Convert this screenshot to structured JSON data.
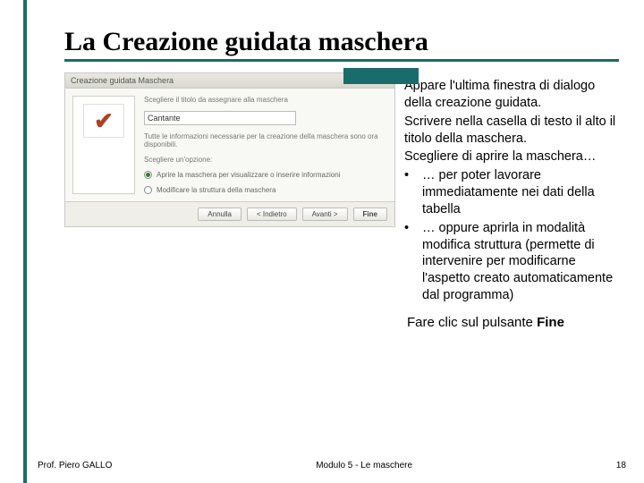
{
  "title": "La Creazione guidata maschera",
  "dialog": {
    "titlebar": "Creazione guidata Maschera",
    "prompt": "Scegliere il titolo da assegnare alla maschera",
    "input_value": "Cantante",
    "desc_line1": "Tutte le informazioni necessarie per la creazione della maschera sono ora disponibili.",
    "desc_line2": "Scegliere un'opzione:",
    "radio1": "Aprire la maschera per visualizzare o inserire informazioni",
    "radio2": "Modificare la struttura della maschera",
    "btn_cancel": "Annulla",
    "btn_back": "< Indietro",
    "btn_next": "Avanti >",
    "btn_finish": "Fine"
  },
  "body": {
    "p1": "Appare l'ultima finestra di dialogo della creazione guidata.",
    "p2": "Scrivere nella casella di testo il alto il titolo della maschera.",
    "p3": "Scegliere di aprire la maschera…",
    "b1": "… per poter lavorare immediatamente nei dati della tabella",
    "b2": "… oppure aprirla in modalità modifica struttura (permette di intervenire per modificarne l'aspetto creato automaticamente dal programma)"
  },
  "closing_prefix": "Fare clic sul pulsante ",
  "closing_bold": "Fine",
  "footer": {
    "author": "Prof. Piero GALLO",
    "center": "Modulo 5  -  Le maschere",
    "page": "18"
  }
}
